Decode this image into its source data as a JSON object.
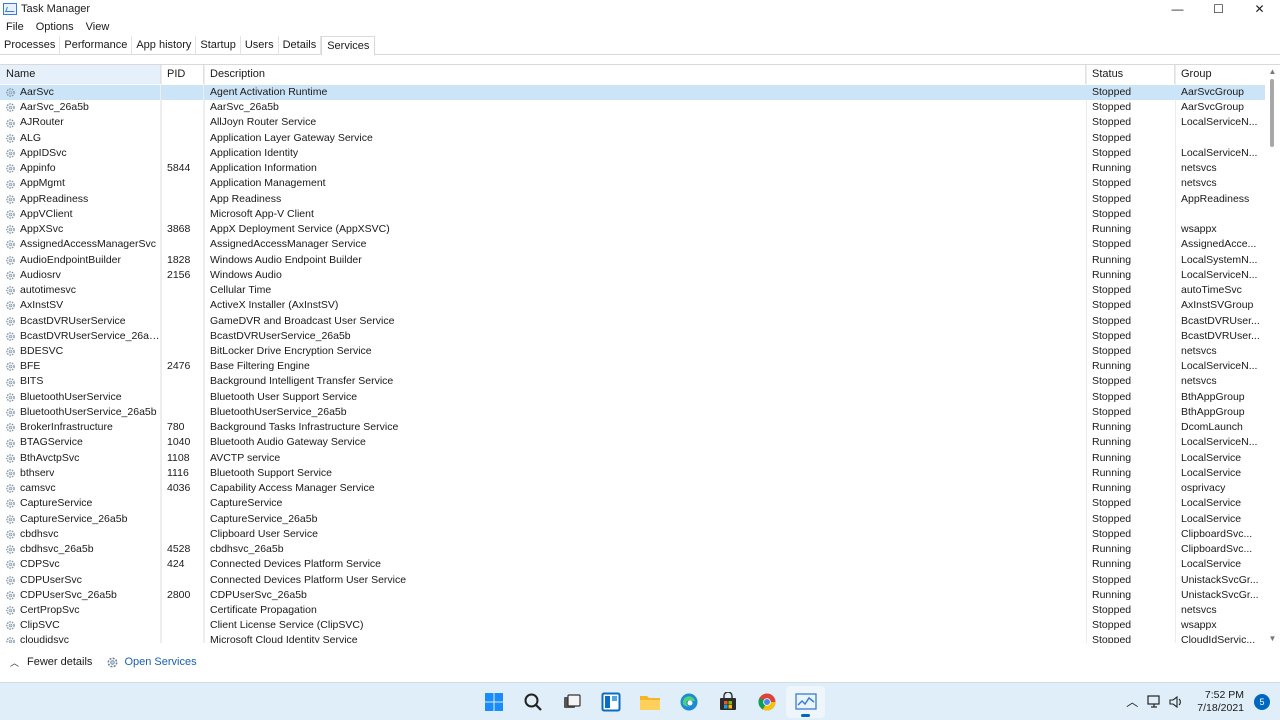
{
  "window": {
    "title": "Task Manager",
    "controls": {
      "minimize": "—",
      "maximize": "☐",
      "close": "✕"
    }
  },
  "menu": [
    "File",
    "Options",
    "View"
  ],
  "tabs": [
    {
      "label": "Processes",
      "active": false
    },
    {
      "label": "Performance",
      "active": false
    },
    {
      "label": "App history",
      "active": false
    },
    {
      "label": "Startup",
      "active": false
    },
    {
      "label": "Users",
      "active": false
    },
    {
      "label": "Details",
      "active": false
    },
    {
      "label": "Services",
      "active": true
    }
  ],
  "columns": {
    "name": "Name",
    "pid": "PID",
    "description": "Description",
    "status": "Status",
    "group": "Group"
  },
  "sort": {
    "column": "name",
    "direction": "ascending"
  },
  "services": [
    {
      "name": "AarSvc",
      "pid": "",
      "description": "Agent Activation Runtime",
      "status": "Stopped",
      "group": "AarSvcGroup",
      "selected": true
    },
    {
      "name": "AarSvc_26a5b",
      "pid": "",
      "description": "AarSvc_26a5b",
      "status": "Stopped",
      "group": "AarSvcGroup"
    },
    {
      "name": "AJRouter",
      "pid": "",
      "description": "AllJoyn Router Service",
      "status": "Stopped",
      "group": "LocalServiceN..."
    },
    {
      "name": "ALG",
      "pid": "",
      "description": "Application Layer Gateway Service",
      "status": "Stopped",
      "group": ""
    },
    {
      "name": "AppIDSvc",
      "pid": "",
      "description": "Application Identity",
      "status": "Stopped",
      "group": "LocalServiceN..."
    },
    {
      "name": "Appinfo",
      "pid": "5844",
      "description": "Application Information",
      "status": "Running",
      "group": "netsvcs"
    },
    {
      "name": "AppMgmt",
      "pid": "",
      "description": "Application Management",
      "status": "Stopped",
      "group": "netsvcs"
    },
    {
      "name": "AppReadiness",
      "pid": "",
      "description": "App Readiness",
      "status": "Stopped",
      "group": "AppReadiness"
    },
    {
      "name": "AppVClient",
      "pid": "",
      "description": "Microsoft App-V Client",
      "status": "Stopped",
      "group": ""
    },
    {
      "name": "AppXSvc",
      "pid": "3868",
      "description": "AppX Deployment Service (AppXSVC)",
      "status": "Running",
      "group": "wsappx"
    },
    {
      "name": "AssignedAccessManagerSvc",
      "pid": "",
      "description": "AssignedAccessManager Service",
      "status": "Stopped",
      "group": "AssignedAcce..."
    },
    {
      "name": "AudioEndpointBuilder",
      "pid": "1828",
      "description": "Windows Audio Endpoint Builder",
      "status": "Running",
      "group": "LocalSystemN..."
    },
    {
      "name": "Audiosrv",
      "pid": "2156",
      "description": "Windows Audio",
      "status": "Running",
      "group": "LocalServiceN..."
    },
    {
      "name": "autotimesvc",
      "pid": "",
      "description": "Cellular Time",
      "status": "Stopped",
      "group": "autoTimeSvc"
    },
    {
      "name": "AxInstSV",
      "pid": "",
      "description": "ActiveX Installer (AxInstSV)",
      "status": "Stopped",
      "group": "AxInstSVGroup"
    },
    {
      "name": "BcastDVRUserService",
      "pid": "",
      "description": "GameDVR and Broadcast User Service",
      "status": "Stopped",
      "group": "BcastDVRUser..."
    },
    {
      "name": "BcastDVRUserService_26a5b",
      "pid": "",
      "description": "BcastDVRUserService_26a5b",
      "status": "Stopped",
      "group": "BcastDVRUser..."
    },
    {
      "name": "BDESVC",
      "pid": "",
      "description": "BitLocker Drive Encryption Service",
      "status": "Stopped",
      "group": "netsvcs"
    },
    {
      "name": "BFE",
      "pid": "2476",
      "description": "Base Filtering Engine",
      "status": "Running",
      "group": "LocalServiceN..."
    },
    {
      "name": "BITS",
      "pid": "",
      "description": "Background Intelligent Transfer Service",
      "status": "Stopped",
      "group": "netsvcs"
    },
    {
      "name": "BluetoothUserService",
      "pid": "",
      "description": "Bluetooth User Support Service",
      "status": "Stopped",
      "group": "BthAppGroup"
    },
    {
      "name": "BluetoothUserService_26a5b",
      "pid": "",
      "description": "BluetoothUserService_26a5b",
      "status": "Stopped",
      "group": "BthAppGroup"
    },
    {
      "name": "BrokerInfrastructure",
      "pid": "780",
      "description": "Background Tasks Infrastructure Service",
      "status": "Running",
      "group": "DcomLaunch"
    },
    {
      "name": "BTAGService",
      "pid": "1040",
      "description": "Bluetooth Audio Gateway Service",
      "status": "Running",
      "group": "LocalServiceN..."
    },
    {
      "name": "BthAvctpSvc",
      "pid": "1108",
      "description": "AVCTP service",
      "status": "Running",
      "group": "LocalService"
    },
    {
      "name": "bthserv",
      "pid": "1116",
      "description": "Bluetooth Support Service",
      "status": "Running",
      "group": "LocalService"
    },
    {
      "name": "camsvc",
      "pid": "4036",
      "description": "Capability Access Manager Service",
      "status": "Running",
      "group": "osprivacy"
    },
    {
      "name": "CaptureService",
      "pid": "",
      "description": "CaptureService",
      "status": "Stopped",
      "group": "LocalService"
    },
    {
      "name": "CaptureService_26a5b",
      "pid": "",
      "description": "CaptureService_26a5b",
      "status": "Stopped",
      "group": "LocalService"
    },
    {
      "name": "cbdhsvc",
      "pid": "",
      "description": "Clipboard User Service",
      "status": "Stopped",
      "group": "ClipboardSvc..."
    },
    {
      "name": "cbdhsvc_26a5b",
      "pid": "4528",
      "description": "cbdhsvc_26a5b",
      "status": "Running",
      "group": "ClipboardSvc..."
    },
    {
      "name": "CDPSvc",
      "pid": "424",
      "description": "Connected Devices Platform Service",
      "status": "Running",
      "group": "LocalService"
    },
    {
      "name": "CDPUserSvc",
      "pid": "",
      "description": "Connected Devices Platform User Service",
      "status": "Stopped",
      "group": "UnistackSvcGr..."
    },
    {
      "name": "CDPUserSvc_26a5b",
      "pid": "2800",
      "description": "CDPUserSvc_26a5b",
      "status": "Running",
      "group": "UnistackSvcGr..."
    },
    {
      "name": "CertPropSvc",
      "pid": "",
      "description": "Certificate Propagation",
      "status": "Stopped",
      "group": "netsvcs"
    },
    {
      "name": "ClipSVC",
      "pid": "",
      "description": "Client License Service (ClipSVC)",
      "status": "Stopped",
      "group": "wsappx"
    },
    {
      "name": "cloudidsvc",
      "pid": "",
      "description": "Microsoft Cloud Identity Service",
      "status": "Stopped",
      "group": "CloudIdServic..."
    }
  ],
  "footer": {
    "fewer_details": "Fewer details",
    "open_services": "Open Services"
  },
  "taskbar": {
    "apps": [
      "windows-start-icon",
      "search-icon",
      "task-view-icon",
      "widgets-icon",
      "file-explorer-icon",
      "edge-icon",
      "store-icon",
      "chrome-icon",
      "task-manager-icon"
    ],
    "time": "7:52 PM",
    "date": "7/18/2021",
    "notifications": "5"
  },
  "colors": {
    "selected_row": "#cce4f7",
    "accent": "#0067c0",
    "link": "#1a5fb4",
    "taskbar": "#dfeef8"
  }
}
